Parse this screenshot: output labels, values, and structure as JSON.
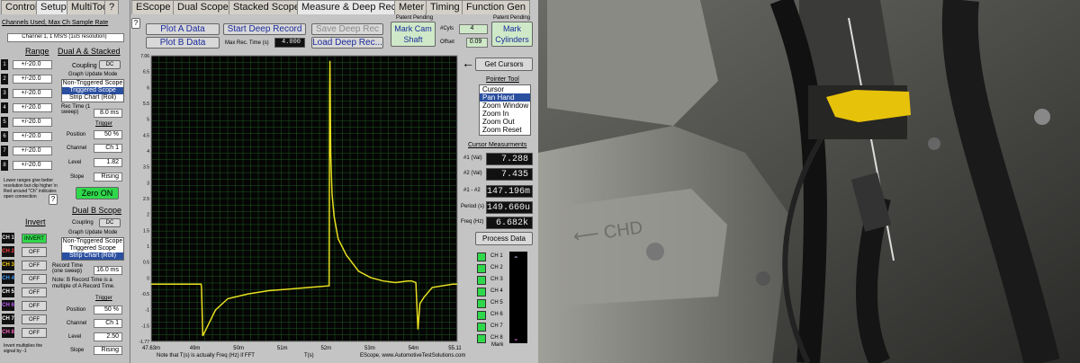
{
  "tabs": {
    "controls": "Controls",
    "setup": "Setup",
    "multitool": "MultiTool",
    "help": "?",
    "escope": "EScope",
    "dual": "Dual Scope",
    "stacked": "Stacked Scope",
    "measure": "Measure & Deep Rec",
    "meter": "Meter",
    "timing": "Timing",
    "fgen": "Function Gen"
  },
  "left": {
    "channels_label": "Channels Used, Max Ch Sample Rate",
    "channels_value": "Channel 1, 1 MS/S (1uS resolution)",
    "range": "Range",
    "dual_stacked": "Dual A & Stacked",
    "ranges": [
      "+/-20.0",
      "+/-20.0",
      "+/-20.0",
      "+/-20.0",
      "+/-20.0",
      "+/-20.0",
      "+/-20.0",
      "+/-20.0"
    ],
    "coupling": "Coupling",
    "dc": "DC",
    "graph_mode": "Graph Update Mode",
    "modes": [
      "Non-Triggered Scope",
      "Triggered Scope",
      "Strip Chart (Roll)"
    ],
    "rec_time": "Rec Time (1 sweep)",
    "rec_time_val": "8.0 ms",
    "trigger": "Trigger",
    "position": "Position",
    "position_val": "50 %",
    "channel": "Channel",
    "channel_val": "Ch 1",
    "level": "Level",
    "level_val": "1.82",
    "slope": "Slope",
    "slope_val": "Rising",
    "note": "Lower ranges give better resolution but clip higher \\n Red around \"Ch\" indicates open connection",
    "zero": "Zero ON",
    "invert": "Invert",
    "dual_b": "Dual B Scope",
    "invert_labels": [
      "INVERT",
      "OFF",
      "OFF",
      "OFF",
      "OFF",
      "OFF",
      "OFF",
      "OFF"
    ],
    "ch_labels": [
      "CH 1",
      "CH 2",
      "CH 3",
      "CH 4",
      "CH 5",
      "CH 6",
      "CH 7",
      "CH 8"
    ],
    "modes_b": [
      "Non-Triggered Scope",
      "Triggered Scope",
      "Strip Chart (Roll)"
    ],
    "record_time": "Record Time (one sweep)",
    "record_time_val": "16.0 ms",
    "b_note": "Note: B Record Time is a multiple of A Record Time.",
    "b_pos": "50 %",
    "b_ch": "Ch 1",
    "b_level": "2.50",
    "b_slope": "Rising",
    "invert_note": "Invert multiplies the signal by -1"
  },
  "toolbar": {
    "plot_a": "Plot A Data",
    "plot_b": "Plot B Data",
    "start_deep": "Start Deep Record",
    "save_deep": "Save Deep Rec",
    "load_deep": "Load Deep Rec...",
    "max_rec": "Max Rec. Time (s)",
    "max_rec_val": "4.000",
    "patent1": "Patent Pending",
    "mark_cam": "Mark Cam Shaft",
    "cyls": "#Cyls",
    "cyls_val": "4",
    "offset": "Offset",
    "offset_val": "0.09",
    "patent2": "Patent Pending",
    "mark_cyl": "Mark Cylinders"
  },
  "right": {
    "get_cursors": "Get Cursors",
    "pointer_tool": "Pointer Tool",
    "tools": [
      "Cursor",
      "Pan Hand",
      "Zoom Window",
      "Zoom In",
      "Zoom Out",
      "Zoom Reset"
    ],
    "cursor_meas": "Cursor Measurments",
    "m1": "#1 (Val)",
    "m1v": "7.288",
    "m2": "#2 (Val)",
    "m2v": "7.435",
    "md": "#1 - #2",
    "mdv": "147.196m",
    "per": "Period (s)",
    "perv": "149.660u",
    "freq": "Freq (Hz)",
    "freqv": "6.682k",
    "process": "Process Data",
    "ch_list": [
      "CH 1",
      "CH 2",
      "CH 3",
      "CH 4",
      "CH 5",
      "CH 6",
      "CH 7",
      "CH 8"
    ],
    "mark": "Mark"
  },
  "bottom": {
    "note": "Note that T(s) is actually Freq (Hz) if FFT",
    "tsec": "T(s)",
    "credit": "EScope, www.AutomotiveTestSolutions.com"
  },
  "chart_data": {
    "type": "line",
    "ylim": [
      -1.77,
      7.06
    ],
    "xlim": [
      0.04763,
      0.05511
    ],
    "yticks": [
      "7.06",
      "6.5",
      "6",
      "5.5",
      "5",
      "4.5",
      "4",
      "3.5",
      "3",
      "2.5",
      "2",
      "1.5",
      "1",
      "0.5",
      "0",
      "-0.5",
      "-1",
      "-1.5",
      "-1.77"
    ],
    "xticks": [
      "47.63m",
      "49m",
      "50m",
      "51m",
      "52m",
      "53m",
      "54m",
      "55.11m"
    ],
    "series": [
      {
        "x": [
          0.04763,
          0.04885,
          0.04886,
          0.04889,
          0.0492,
          0.0495,
          0.05,
          0.0505,
          0.051,
          0.0515,
          0.05198,
          0.05199,
          0.052,
          0.05202,
          0.05205,
          0.0521,
          0.0522,
          0.0524,
          0.0527,
          0.053,
          0.0533,
          0.0536,
          0.0539,
          0.054,
          0.0541,
          0.05415,
          0.0542,
          0.0543,
          0.0545,
          0.055,
          0.05511
        ],
        "y": [
          0,
          0,
          -0.1,
          -1.6,
          -0.8,
          -0.45,
          -0.3,
          -0.2,
          -0.15,
          -0.1,
          -0.05,
          5.8,
          6.9,
          4.0,
          2.8,
          2.1,
          1.4,
          0.9,
          0.4,
          0.2,
          0.1,
          0.05,
          0.1,
          0.1,
          0.05,
          -1.4,
          -0.6,
          -0.4,
          -0.1,
          0,
          0
        ]
      }
    ]
  },
  "colors": {
    "grid": "#1f5a1f",
    "trace": "#e8e020",
    "chart_bg": "#050505"
  }
}
